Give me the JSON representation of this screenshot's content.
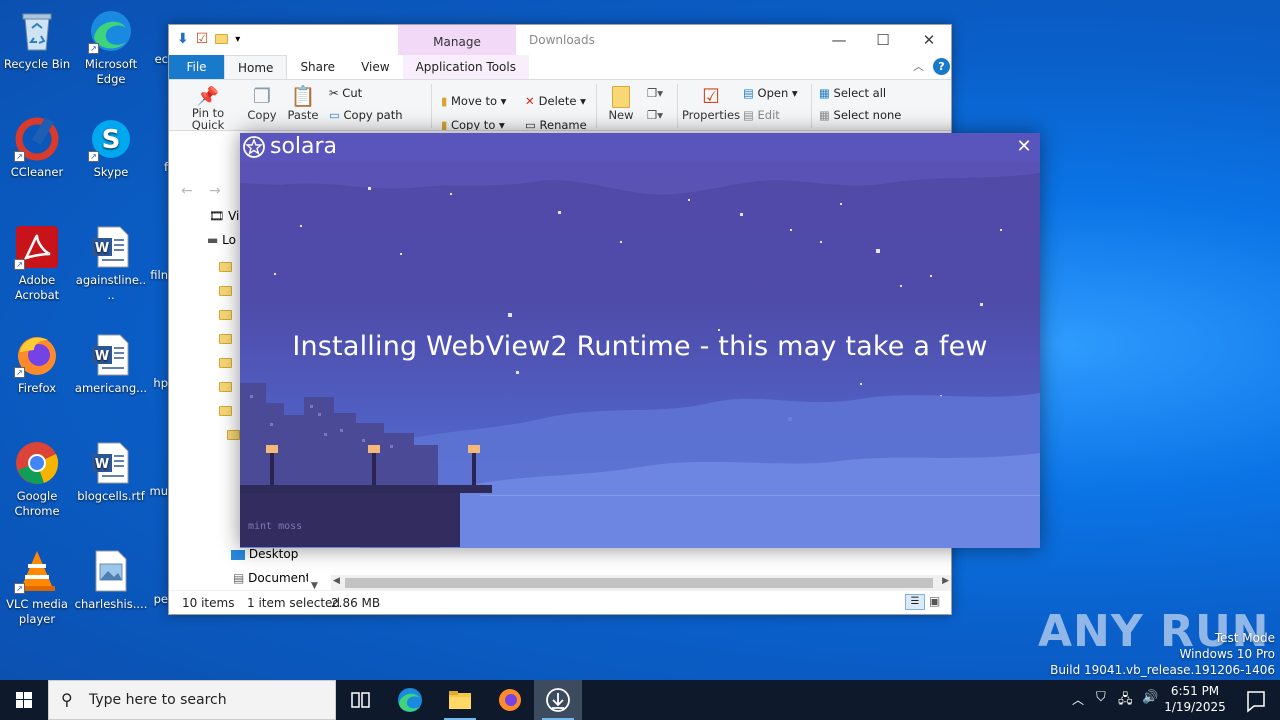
{
  "desktop": {
    "icons": [
      {
        "label": "Recycle Bin"
      },
      {
        "label": "Microsoft Edge"
      },
      {
        "label": "ec"
      },
      {
        "label": "CCleaner"
      },
      {
        "label": "Skype"
      },
      {
        "label": "f"
      },
      {
        "label": "Adobe Acrobat"
      },
      {
        "label": "againstline...."
      },
      {
        "label": "filn"
      },
      {
        "label": "Firefox"
      },
      {
        "label": "americang..."
      },
      {
        "label": "hp"
      },
      {
        "label": "Google Chrome"
      },
      {
        "label": "blogcells.rtf"
      },
      {
        "label": "mu"
      },
      {
        "label": "VLC media player"
      },
      {
        "label": "charleshis...."
      },
      {
        "label": "pe"
      }
    ]
  },
  "explorer": {
    "manage_tab": "Manage",
    "title": "Downloads",
    "tabs": [
      "File",
      "Home",
      "Share",
      "View",
      "Application Tools"
    ],
    "ribbon": {
      "pin": "Pin to Quick access",
      "copy": "Copy",
      "paste": "Paste",
      "cut": "Cut",
      "copy_path": "Copy path",
      "move_to": "Move to",
      "copy_to": "Copy to",
      "delete": "Delete",
      "rename": "Rename",
      "new": "New",
      "properties": "Properties",
      "open": "Open",
      "edit": "Edit",
      "select_all": "Select all",
      "select_none": "Select none"
    },
    "tree": {
      "vi": "Vi",
      "lo": "Lo",
      "desktop": "Desktop",
      "documents": "Document"
    },
    "status": {
      "items": "10 items",
      "selected": "1 item selected",
      "size": "2.86 MB"
    }
  },
  "solara": {
    "brand": "solara",
    "message": "Installing WebView2 Runtime - this may take a few",
    "signature": "mint moss"
  },
  "watermark": {
    "brand": "ANY RUN",
    "line1": "Test Mode",
    "line2": "Windows 10 Pro",
    "line3": "Build 19041.vb_release.191206-1406"
  },
  "taskbar": {
    "search_placeholder": "Type here to search",
    "time": "6:51 PM",
    "date": "1/19/2025"
  },
  "colors": {
    "explorer_accent": "#1979ca",
    "manage_tab": "#f2d9f7",
    "solara_header": "#5a55bd",
    "taskbar": "#0e1a2b"
  }
}
